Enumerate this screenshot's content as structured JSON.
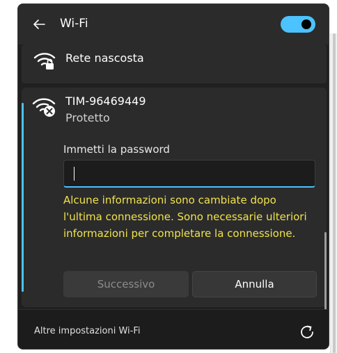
{
  "header": {
    "title": "Wi-Fi",
    "back_icon": "arrow-left-icon",
    "toggle_on": true
  },
  "networks": {
    "hidden": {
      "label": "Rete nascosta",
      "icon": "wifi-lock-icon"
    },
    "selected": {
      "name": "TIM-96469449",
      "status": "Protetto",
      "icon": "wifi-error-icon",
      "password_label": "Immetti la password",
      "password_value": "",
      "warning": "Alcune informazioni sono cambiate dopo l'ultima connessione. Sono necessarie ulteriori informazioni per completare la connessione.",
      "next_label": "Successivo",
      "cancel_label": "Annulla"
    }
  },
  "footer": {
    "more_settings": "Altre impostazioni Wi-Fi",
    "refresh_icon": "refresh-icon"
  },
  "colors": {
    "accent": "#4cc2ff",
    "warning": "#f1e34a",
    "panel_bg": "#202020",
    "card_bg": "#2b2b2b"
  }
}
